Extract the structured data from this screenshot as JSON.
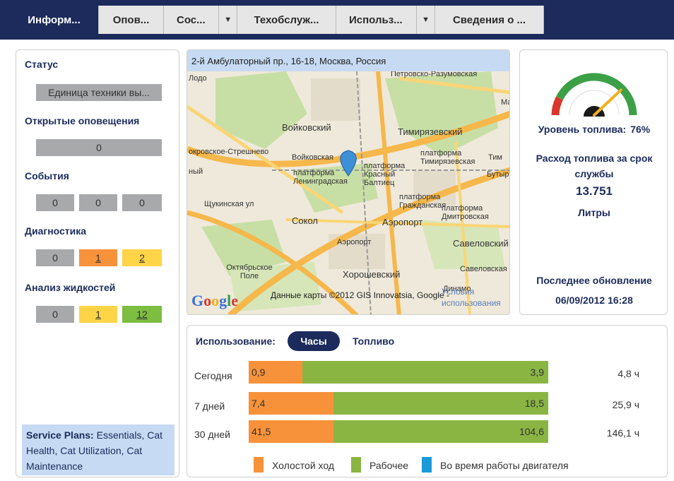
{
  "tabs": [
    {
      "label": "Информ...",
      "active": true,
      "dropdown": false
    },
    {
      "label": "Опов...",
      "active": false,
      "dropdown": false
    },
    {
      "label": "Сос...",
      "active": false,
      "dropdown": true
    },
    {
      "label": "Техобслуж...",
      "active": false,
      "dropdown": false
    },
    {
      "label": "Использ...",
      "active": false,
      "dropdown": true
    },
    {
      "label": "Сведения о ...",
      "active": false,
      "dropdown": false
    }
  ],
  "left": {
    "status_title": "Статус",
    "status_value": "Единица техники вы...",
    "alerts_title": "Открытые оповещения",
    "alerts_value": "0",
    "events_title": "События",
    "events_values": [
      "0",
      "0",
      "0"
    ],
    "diag_title": "Диагностика",
    "diag_values": [
      "0",
      "1",
      "2"
    ],
    "fluids_title": "Анализ жидкостей",
    "fluids_values": [
      "0",
      "1",
      "12"
    ],
    "service_label": "Service Plans:",
    "service_text": " Essentials, Cat Health, Cat Utilization, Cat Maintenance"
  },
  "map": {
    "address": "2-й Амбулаторный пр., 16-18, Москва, Россия",
    "labels": [
      "Петровско-Разумовская",
      "Войковский",
      "Тимирязевский",
      "окровское-Стрешнево",
      "Войковская",
      "платформа Тимирязевская",
      "платформа Красный Балтиец",
      "платформа Ленинградская",
      "Щукинская ул",
      "Сокол",
      "платформа Гражданская",
      "платформа Дмитровская",
      "Аэропорт",
      "Савеловский",
      "Октябрьское Поле",
      "Хорошевский",
      "Савеловская",
      "Динамо",
      "Бутыр",
      "Ма",
      "Лодо",
      "Тим",
      "ный"
    ],
    "logo": "Google",
    "copyright": "Данные карты ©2012 GIS Innovatsia, Google -",
    "terms": "Условия использования"
  },
  "fuel": {
    "level_label": "Уровень топлива:",
    "level_value": "76%",
    "level_fraction": 0.76,
    "rate_title": "Расход топлива за срок службы",
    "rate_value": "13.751",
    "rate_unit": "Литры",
    "update_title": "Последнее обновление",
    "update_value": "06/09/2012 16:28"
  },
  "usage": {
    "label": "Использование:",
    "btn_hours": "Часы",
    "btn_fuel": "Топливо",
    "rows": [
      {
        "name": "Сегодня",
        "idle": "0,9",
        "work": "3,9",
        "total": "4,8 ч"
      },
      {
        "name": "7 дней",
        "idle": "7,4",
        "work": "18,5",
        "total": "25,9 ч"
      },
      {
        "name": "30 дней",
        "idle": "41,5",
        "work": "104,6",
        "total": "146,1 ч"
      }
    ],
    "legend": [
      "Холостой ход",
      "Рабочее",
      "Во время работы двигателя"
    ],
    "colors": {
      "idle": "#f7923a",
      "work": "#8ab543",
      "engine": "#1a9ad9"
    }
  }
}
